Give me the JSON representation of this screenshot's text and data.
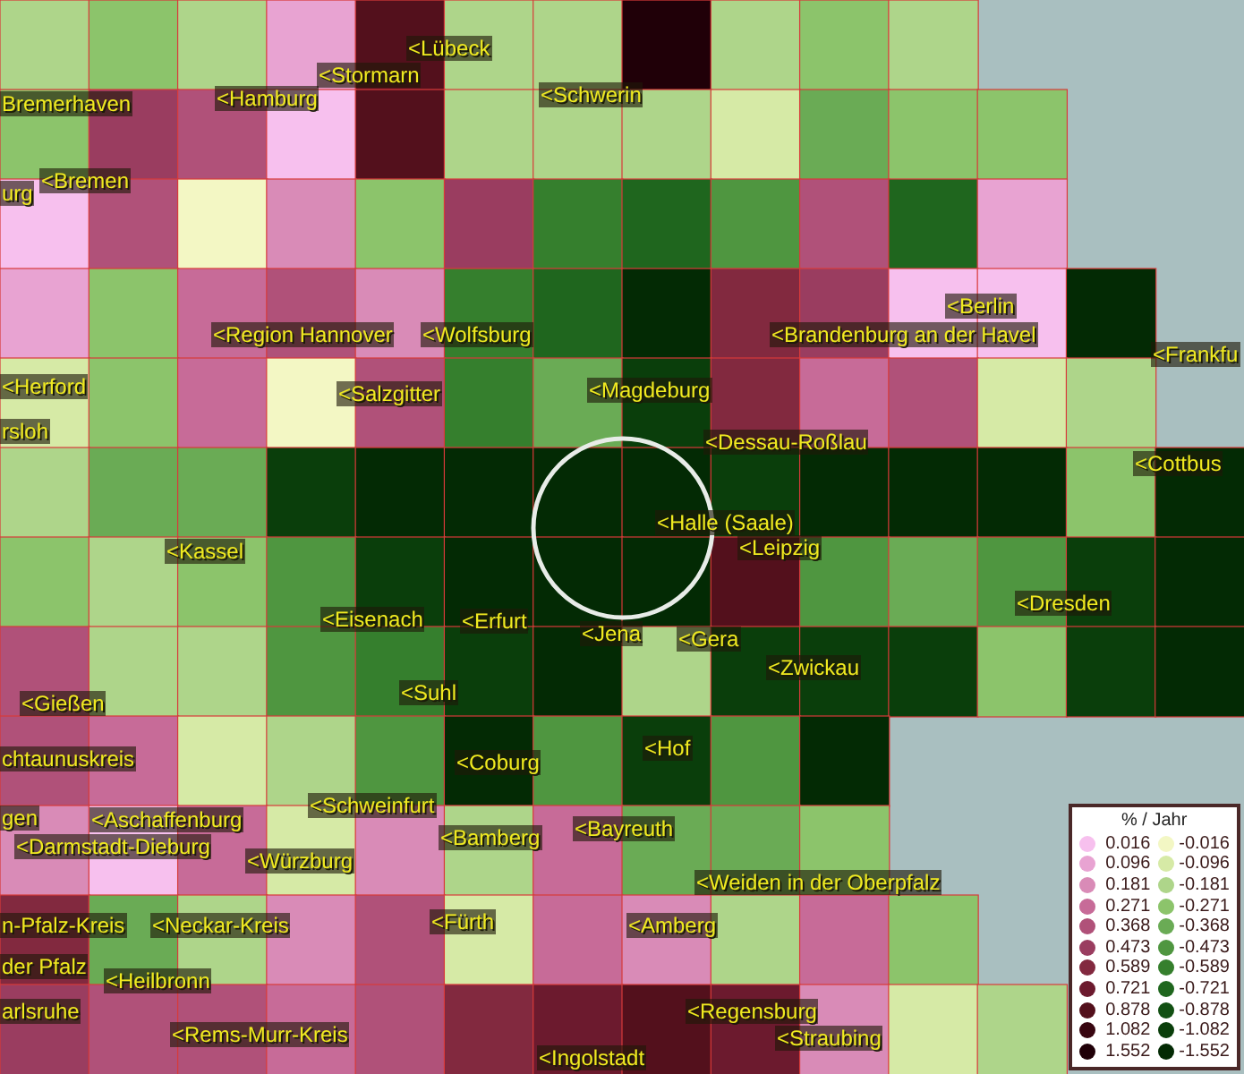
{
  "map": {
    "labels": [
      "<Lübeck",
      "<Stormarn",
      "Bremerhaven",
      "<Hamburg",
      "<Schwerin",
      "urg",
      "<Bremen",
      "<Berlin",
      "<Region Hannover",
      "<Wolfsburg",
      "<Brandenburg an der Havel",
      "<Frankfu",
      "<Herford",
      "<Salzgitter",
      "<Magdeburg",
      "rsloh",
      "<Dessau-Roßlau",
      "<Cottbus",
      "<Halle (Saale)",
      "<Kassel",
      "<Leipzig",
      "<Dresden",
      "<Eisenach",
      "<Erfurt",
      "<Jena",
      "<Gera",
      "<Zwickau",
      "<Gießen",
      "<Suhl",
      "chtaunuskreis",
      "<Coburg",
      "<Hof",
      "gen",
      "<Aschaffenburg",
      "<Schweinfurt",
      "<Bamberg",
      "<Bayreuth",
      "<Darmstadt-Dieburg",
      "<Würzburg",
      "<Weiden in der Oberpfalz",
      "n-Pfalz-Kreis",
      "<Neckar-Kreis",
      "<Fürth",
      "<Amberg",
      "der Pfalz",
      "<Heilbronn",
      "arlsruhe",
      "<Regensburg",
      "<Rems-Murr-Kreis",
      "<Straubing",
      "<Ingolstadt"
    ]
  },
  "legend": {
    "title": "% / Jahr",
    "positive": [
      {
        "value": "0.016",
        "color": "#f7c0ee"
      },
      {
        "value": "0.096",
        "color": "#e8a3d2"
      },
      {
        "value": "0.181",
        "color": "#d98bb7"
      },
      {
        "value": "0.271",
        "color": "#c76b98"
      },
      {
        "value": "0.368",
        "color": "#b05179"
      },
      {
        "value": "0.473",
        "color": "#9a3d60"
      },
      {
        "value": "0.589",
        "color": "#82293f"
      },
      {
        "value": "0.721",
        "color": "#6c1a2e"
      },
      {
        "value": "0.878",
        "color": "#53101c"
      },
      {
        "value": "1.082",
        "color": "#380610"
      },
      {
        "value": "1.552",
        "color": "#200008"
      }
    ],
    "negative": [
      {
        "value": "-0.016",
        "color": "#f3f7c4"
      },
      {
        "value": "-0.096",
        "color": "#d6eaa6"
      },
      {
        "value": "-0.181",
        "color": "#aed58a"
      },
      {
        "value": "-0.271",
        "color": "#8cc46b"
      },
      {
        "value": "-0.368",
        "color": "#6aab55"
      },
      {
        "value": "-0.473",
        "color": "#4f9640"
      },
      {
        "value": "-0.589",
        "color": "#357f2d"
      },
      {
        "value": "-0.721",
        "color": "#1f661e"
      },
      {
        "value": "-0.878",
        "color": "#125013"
      },
      {
        "value": "-1.082",
        "color": "#0a3e0b"
      },
      {
        "value": "-1.552",
        "color": "#032a04"
      }
    ]
  }
}
